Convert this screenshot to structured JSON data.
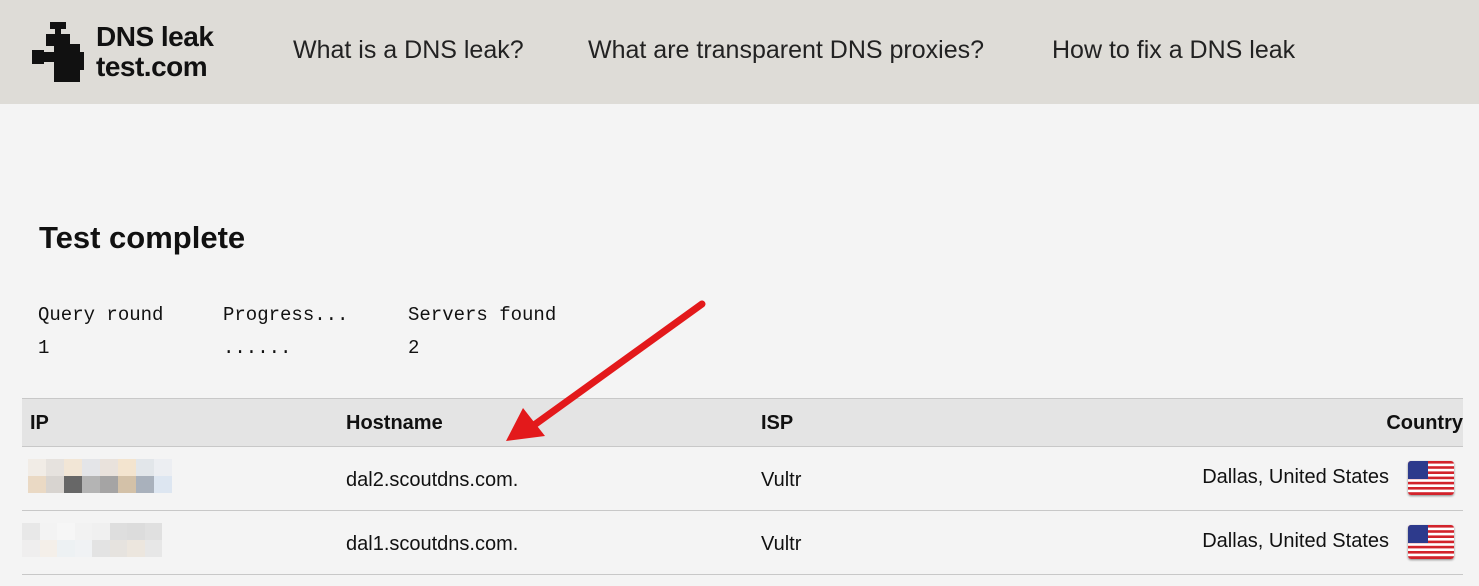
{
  "header": {
    "logo_line1": "DNS leak",
    "logo_line2": "test.com",
    "nav": [
      {
        "label": "What is a DNS leak?"
      },
      {
        "label": "What are transparent DNS proxies?"
      },
      {
        "label": "How to fix a DNS leak"
      }
    ]
  },
  "main": {
    "title": "Test complete",
    "stats": {
      "query_round_label": "Query round",
      "query_round_value": "1",
      "progress_label": "Progress...",
      "progress_value": "......",
      "servers_found_label": "Servers found",
      "servers_found_value": "2"
    },
    "table": {
      "headers": {
        "ip": "IP",
        "hostname": "Hostname",
        "isp": "ISP",
        "country": "Country"
      },
      "rows": [
        {
          "ip": "",
          "hostname": "dal2.scoutdns.com.",
          "isp": "Vultr",
          "country": "Dallas, United States",
          "flag_icon": "us-flag-icon"
        },
        {
          "ip": "",
          "hostname": "dal1.scoutdns.com.",
          "isp": "Vultr",
          "country": "Dallas, United States",
          "flag_icon": "us-flag-icon"
        }
      ]
    }
  },
  "colors": {
    "header_bg": "#dedcd7",
    "page_bg": "#f4f4f4",
    "table_header_bg": "#e4e4e4",
    "arrow": "#e3191b"
  }
}
